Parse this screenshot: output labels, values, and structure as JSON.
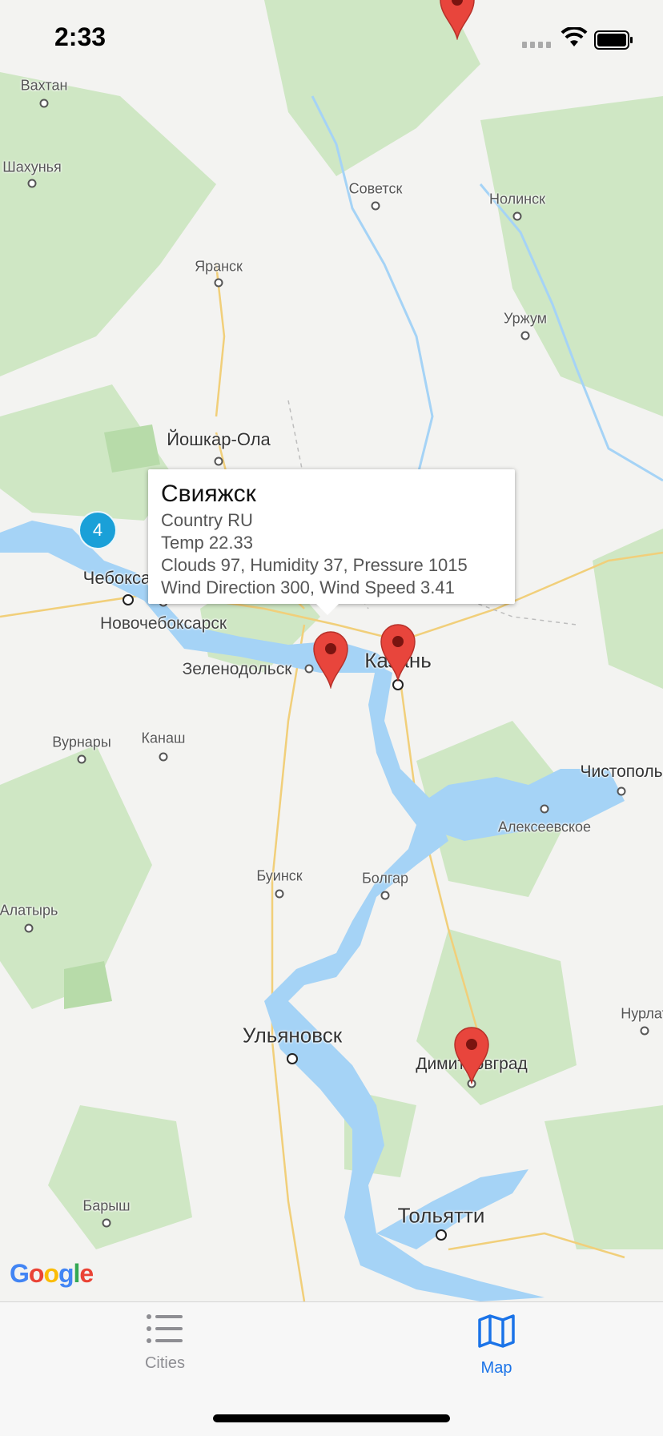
{
  "status_bar": {
    "time": "2:33"
  },
  "map": {
    "cities": [
      {
        "name": "Вахтан",
        "size": "small"
      },
      {
        "name": "Шахунья",
        "size": "small"
      },
      {
        "name": "Советск",
        "size": "small"
      },
      {
        "name": "Нолинск",
        "size": "small"
      },
      {
        "name": "Яранск",
        "size": "small"
      },
      {
        "name": "Уржум",
        "size": "small"
      },
      {
        "name": "Йошкар-Ола",
        "size": "medium"
      },
      {
        "name": "Чебоксары",
        "size": "medium"
      },
      {
        "name": "Новочебоксарск",
        "size": "medium"
      },
      {
        "name": "Зеленодольск",
        "size": "medium"
      },
      {
        "name": "Казань",
        "size": "big"
      },
      {
        "name": "Вурнары",
        "size": "small"
      },
      {
        "name": "Канаш",
        "size": "small"
      },
      {
        "name": "Чистополь",
        "size": "medium"
      },
      {
        "name": "Алексеевское",
        "size": "small"
      },
      {
        "name": "Буинск",
        "size": "small"
      },
      {
        "name": "Болгар",
        "size": "small"
      },
      {
        "name": "Алатырь",
        "size": "small"
      },
      {
        "name": "Ульяновск",
        "size": "big"
      },
      {
        "name": "Димитровград",
        "size": "medium"
      },
      {
        "name": "Нурлат",
        "size": "small"
      },
      {
        "name": "Барыш",
        "size": "small"
      },
      {
        "name": "Тольятти",
        "size": "big"
      }
    ],
    "cluster_count": "4",
    "popup": {
      "title": "Свияжск",
      "country": "Country RU",
      "temp": "Temp 22.33",
      "details": "Clouds 97, Humidity 37, Pressure 1015",
      "wind": "Wind Direction 300, Wind Speed 3.41"
    },
    "attribution": "Google",
    "colors": {
      "water": "#a5d3f6",
      "forest": "#cfe7c4",
      "pin": "#e8453c",
      "cluster": "#1aa0d8"
    }
  },
  "tabs": [
    {
      "label": "Cities",
      "icon": "list-icon",
      "active": false
    },
    {
      "label": "Map",
      "icon": "map-icon",
      "active": true
    }
  ],
  "active_color": "#1a73e8"
}
